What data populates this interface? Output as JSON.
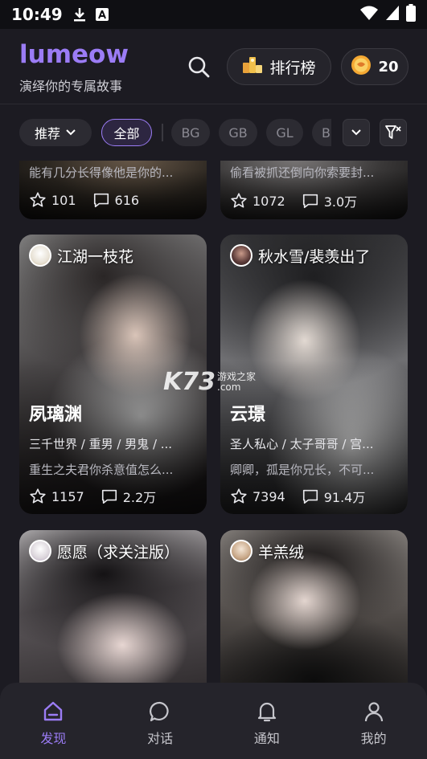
{
  "status": {
    "time": "10:49"
  },
  "header": {
    "logo": "lumeow",
    "tagline": "演绎你的专属故事",
    "rank_label": "排行榜",
    "coins": "20"
  },
  "filters": {
    "sort_label": "推荐",
    "all_label": "全部",
    "chips": [
      "BG",
      "GB",
      "GL",
      "Bl"
    ]
  },
  "cards": [
    {
      "desc": "能有几分长得像他是你的...",
      "likes": "101",
      "comments": "616"
    },
    {
      "desc": "偷看被抓还倒向你索要封...",
      "likes": "1072",
      "comments": "3.0万"
    },
    {
      "author": "江湖一枝花",
      "name": "夙璃渊",
      "tags": "三千世界 / 重男 / 男鬼 / ...",
      "desc": "重生之夫君你杀意值怎么...",
      "likes": "1157",
      "comments": "2.2万"
    },
    {
      "author": "秋水雪/裴羡出了",
      "name": "云璟",
      "tags": "圣人私心 / 太子哥哥 / 宫...",
      "desc": "卿卿，孤是你兄长，不可...",
      "likes": "7394",
      "comments": "91.4万"
    },
    {
      "author": "愿愿（求关注版）"
    },
    {
      "author": "羊羔绒"
    }
  ],
  "watermark": {
    "big": "K73",
    "small1": "游戏之家",
    "small2": ".com"
  },
  "nav": [
    {
      "label": "发现"
    },
    {
      "label": "对话"
    },
    {
      "label": "通知"
    },
    {
      "label": "我的"
    }
  ],
  "colors": {
    "accent": "#9b7cf5",
    "background": "#1c1b22",
    "nav_bg": "#25242b"
  }
}
